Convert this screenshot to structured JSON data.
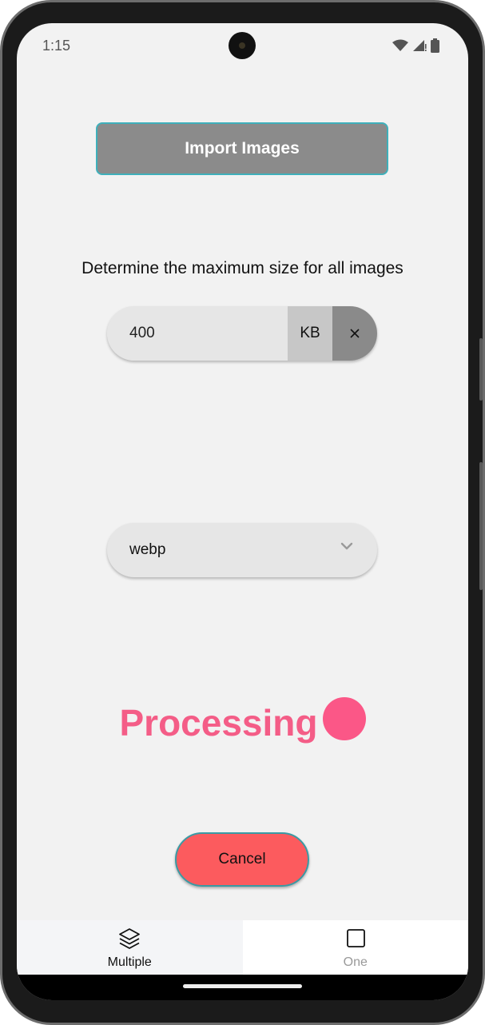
{
  "status_bar": {
    "time": "1:15",
    "icons": [
      "wifi-icon",
      "signal-icon",
      "battery-icon"
    ]
  },
  "main": {
    "import_button_label": "Import Images",
    "instruction": "Determine the maximum size for all images",
    "size_field": {
      "value": "400",
      "unit": "KB",
      "clear_icon": "close-icon"
    },
    "format_select": {
      "selected": "webp",
      "icon": "chevron-down-icon"
    },
    "processing_label": "Processing",
    "cancel_label": "Cancel"
  },
  "bottom_nav": {
    "items": [
      {
        "label": "Multiple",
        "icon": "layers-icon",
        "active": true
      },
      {
        "label": "One",
        "icon": "square-icon",
        "active": false
      }
    ]
  },
  "colors": {
    "accent_teal": "#3fb0bb",
    "import_button": "#8b8b8b",
    "processing_pink": "#f45d87",
    "cancel_red": "#fc5b5e"
  }
}
